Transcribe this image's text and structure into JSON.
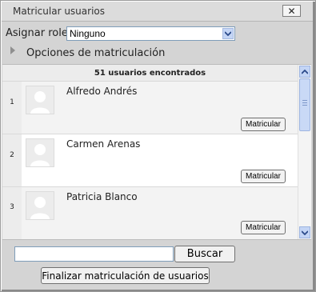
{
  "dialog": {
    "title": "Matricular usuarios",
    "close_label": "✕"
  },
  "roles": {
    "label": "Asignar roles",
    "selected": "Ninguno"
  },
  "options": {
    "label": "Opciones de matriculación"
  },
  "list": {
    "count_text": "51 usuarios encontrados",
    "users": [
      {
        "num": "1",
        "name": "Alfredo Andrés",
        "button": "Matricular"
      },
      {
        "num": "2",
        "name": "Carmen Arenas",
        "button": "Matricular"
      },
      {
        "num": "3",
        "name": "Patricia Blanco",
        "button": "Matricular"
      }
    ]
  },
  "search": {
    "value": "",
    "button": "Buscar"
  },
  "finish": {
    "button": "Finalizar matriculación de usuarios"
  }
}
